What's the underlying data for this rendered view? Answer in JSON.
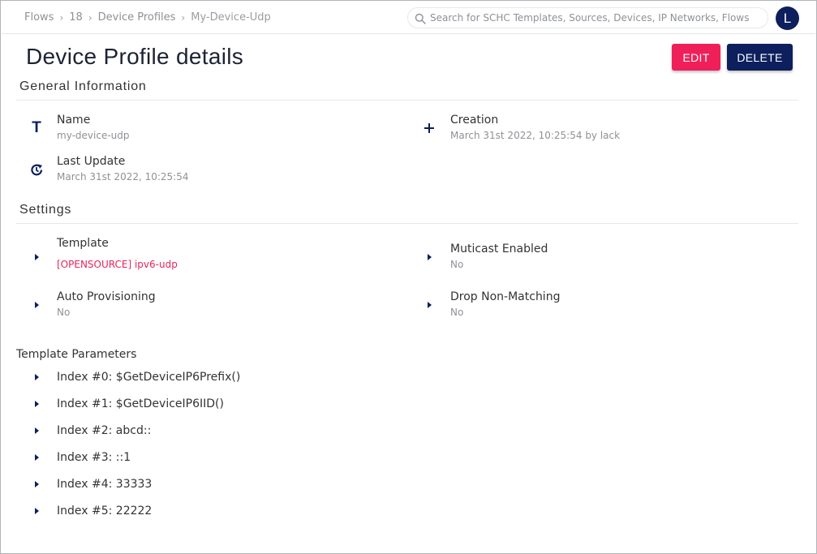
{
  "breadcrumb": [
    {
      "label": "Flows"
    },
    {
      "label": "18"
    },
    {
      "label": "Device Profiles"
    },
    {
      "label": "My-Device-Udp"
    }
  ],
  "breadcrumb_separator": "›",
  "search": {
    "placeholder": "Search for SCHC Templates, Sources, Devices, IP Networks, Flows",
    "value": "",
    "icon": "search-icon"
  },
  "user": {
    "avatar_initial": "L"
  },
  "page": {
    "title": "Device Profile details",
    "edit_label": "EDIT",
    "delete_label": "DELETE"
  },
  "colors": {
    "primary": "#0d1f5c",
    "accent": "#ef1f5a",
    "muted_text": "#8e9196"
  },
  "general": {
    "title": "General Information",
    "name": {
      "label": "Name",
      "value": "my-device-udp",
      "icon": "text-icon",
      "icon_glyph": "T"
    },
    "creation": {
      "label": "Creation",
      "value": "March 31st 2022, 10:25:54 by lack",
      "icon": "plus-icon",
      "icon_glyph": "+"
    },
    "last_update": {
      "label": "Last Update",
      "value": "March 31st 2022, 10:25:54",
      "icon": "history-icon"
    }
  },
  "settings": {
    "title": "Settings",
    "template": {
      "label": "Template",
      "value": "[OPENSOURCE] ipv6-udp"
    },
    "multicast": {
      "label": "Muticast Enabled",
      "value": "No"
    },
    "auto_provisioning": {
      "label": "Auto Provisioning",
      "value": "No"
    },
    "drop_non_matching": {
      "label": "Drop Non-Matching",
      "value": "No"
    }
  },
  "template_parameters": {
    "title": "Template Parameters",
    "items": [
      "Index #0: $GetDeviceIP6Prefix()",
      "Index #1: $GetDeviceIP6IID()",
      "Index #2: abcd::",
      "Index #3: ::1",
      "Index #4: 33333",
      "Index #5: 22222"
    ]
  }
}
